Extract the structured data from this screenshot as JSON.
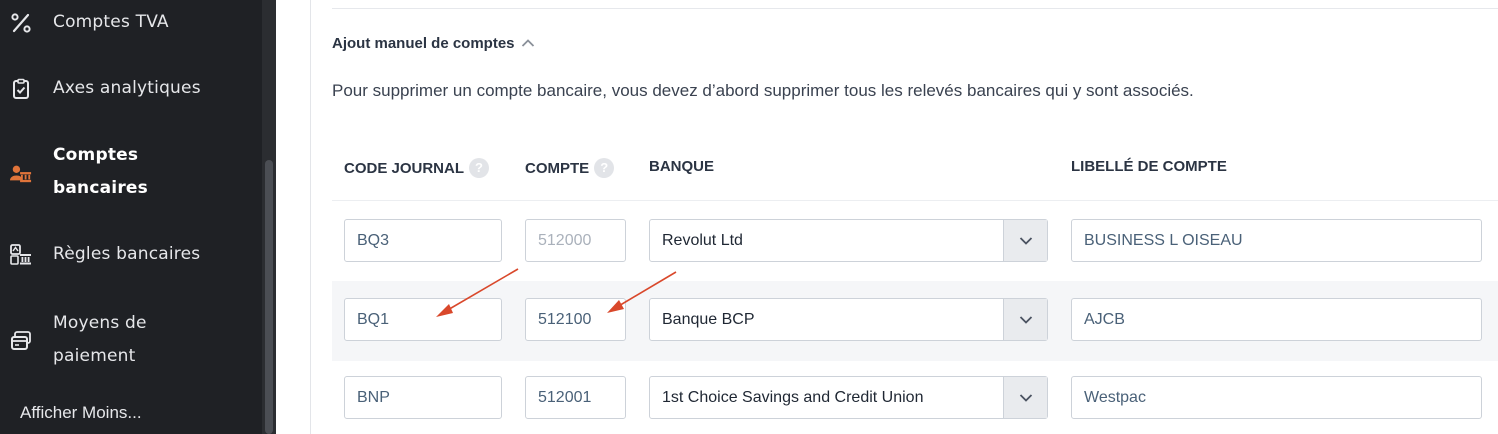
{
  "sidebar": {
    "items": [
      {
        "label": "Comptes TVA",
        "icon": "percent-icon"
      },
      {
        "label": "Axes analytiques",
        "icon": "clipboard-check-icon"
      },
      {
        "label_line1": "Comptes",
        "label_line2": "bancaires",
        "icon": "bank-users-icon",
        "active": true
      },
      {
        "label": "Règles bancaires",
        "icon": "bank-rules-icon"
      },
      {
        "label_line1": "Moyens de",
        "label_line2": "paiement",
        "icon": "payment-cards-icon"
      }
    ],
    "show_less": "Afficher Moins..."
  },
  "section": {
    "title": "Ajout manuel de comptes",
    "info": "Pour supprimer un compte bancaire, vous devez d’abord supprimer tous les relevés bancaires qui y sont associés."
  },
  "table": {
    "headers": {
      "code_journal": "CODE JOURNAL",
      "compte": "COMPTE",
      "banque": "BANQUE",
      "libelle": "LIBELLÉ DE COMPTE"
    },
    "rows": [
      {
        "code": "BQ3",
        "compte": "512000",
        "banque": "Revolut Ltd",
        "libelle": "BUSINESS L OISEAU"
      },
      {
        "code": "BQ1",
        "compte": "512100",
        "banque": "Banque BCP",
        "libelle": "AJCB"
      },
      {
        "code": "BNP",
        "compte": "512001",
        "banque": "1st Choice Savings and Credit Union",
        "libelle": "Westpac"
      }
    ]
  },
  "colors": {
    "sidebar_bg": "#1f2125",
    "active_icon": "#e0743a",
    "annotation_arrow": "#d9482b"
  }
}
